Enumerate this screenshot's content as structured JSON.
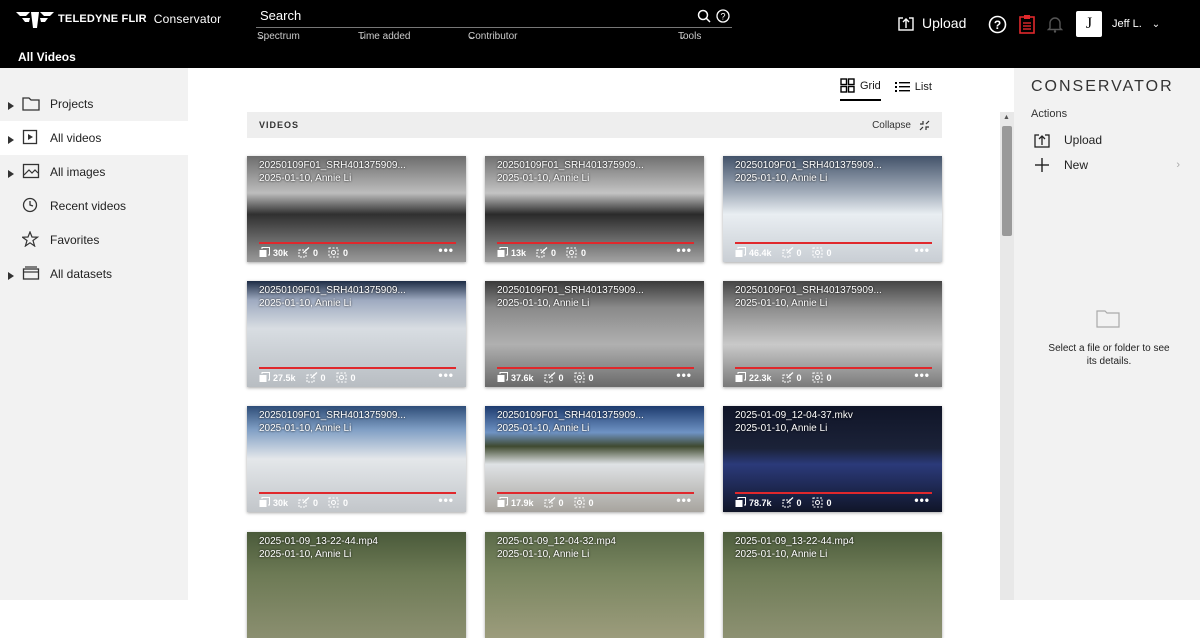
{
  "header": {
    "brand_bold": "TELEDYNE FLIR",
    "brand_light": "Conservator",
    "breadcrumb": "All Videos",
    "search_placeholder": "Search",
    "filters": [
      "Spectrum",
      "Time added",
      "Contributor",
      "Tools"
    ],
    "upload_label": "Upload",
    "user_initial": "J",
    "user_name": "Jeff L."
  },
  "sidebar": {
    "items": [
      {
        "label": "Projects",
        "icon": "folder-icon",
        "caret": true
      },
      {
        "label": "All videos",
        "icon": "video-icon",
        "caret": true,
        "active": true
      },
      {
        "label": "All images",
        "icon": "image-icon",
        "caret": true
      },
      {
        "label": "Recent videos",
        "icon": "clock-icon",
        "caret": false
      },
      {
        "label": "Favorites",
        "icon": "star-icon",
        "caret": false
      },
      {
        "label": "All datasets",
        "icon": "dataset-icon",
        "caret": true
      }
    ]
  },
  "main": {
    "view_grid": "Grid",
    "view_list": "List",
    "section_title": "VIDEOS",
    "collapse_label": "Collapse",
    "videos": [
      {
        "name": "20250109F01_SRH401375909...",
        "sub": "2025-01-10, Annie Li",
        "frames": "30k",
        "ann": "0",
        "tags": "0"
      },
      {
        "name": "20250109F01_SRH401375909...",
        "sub": "2025-01-10, Annie Li",
        "frames": "13k",
        "ann": "0",
        "tags": "0"
      },
      {
        "name": "20250109F01_SRH401375909...",
        "sub": "2025-01-10, Annie Li",
        "frames": "46.4k",
        "ann": "0",
        "tags": "0"
      },
      {
        "name": "20250109F01_SRH401375909...",
        "sub": "2025-01-10, Annie Li",
        "frames": "27.5k",
        "ann": "0",
        "tags": "0"
      },
      {
        "name": "20250109F01_SRH401375909...",
        "sub": "2025-01-10, Annie Li",
        "frames": "37.6k",
        "ann": "0",
        "tags": "0"
      },
      {
        "name": "20250109F01_SRH401375909...",
        "sub": "2025-01-10, Annie Li",
        "frames": "22.3k",
        "ann": "0",
        "tags": "0"
      },
      {
        "name": "20250109F01_SRH401375909...",
        "sub": "2025-01-10, Annie Li",
        "frames": "30k",
        "ann": "0",
        "tags": "0"
      },
      {
        "name": "20250109F01_SRH401375909...",
        "sub": "2025-01-10, Annie Li",
        "frames": "17.9k",
        "ann": "0",
        "tags": "0"
      },
      {
        "name": "2025-01-09_12-04-37.mkv",
        "sub": "2025-01-10, Annie Li",
        "frames": "78.7k",
        "ann": "0",
        "tags": "0"
      },
      {
        "name": "2025-01-09_13-22-44.mp4",
        "sub": "2025-01-10, Annie Li",
        "frames": "",
        "ann": "",
        "tags": ""
      },
      {
        "name": "2025-01-09_12-04-32.mp4",
        "sub": "2025-01-10, Annie Li",
        "frames": "",
        "ann": "",
        "tags": ""
      },
      {
        "name": "2025-01-09_13-22-44.mp4",
        "sub": "2025-01-10, Annie Li",
        "frames": "",
        "ann": "",
        "tags": ""
      }
    ]
  },
  "right_panel": {
    "title": "CONSERVATOR",
    "actions_label": "Actions",
    "upload_label": "Upload",
    "new_label": "New",
    "empty_text": "Select a file or folder to see its details."
  },
  "colors": {
    "accent_red": "#e0282c",
    "topbar_bg": "#000000",
    "sidebar_bg": "#f2f2f2"
  }
}
